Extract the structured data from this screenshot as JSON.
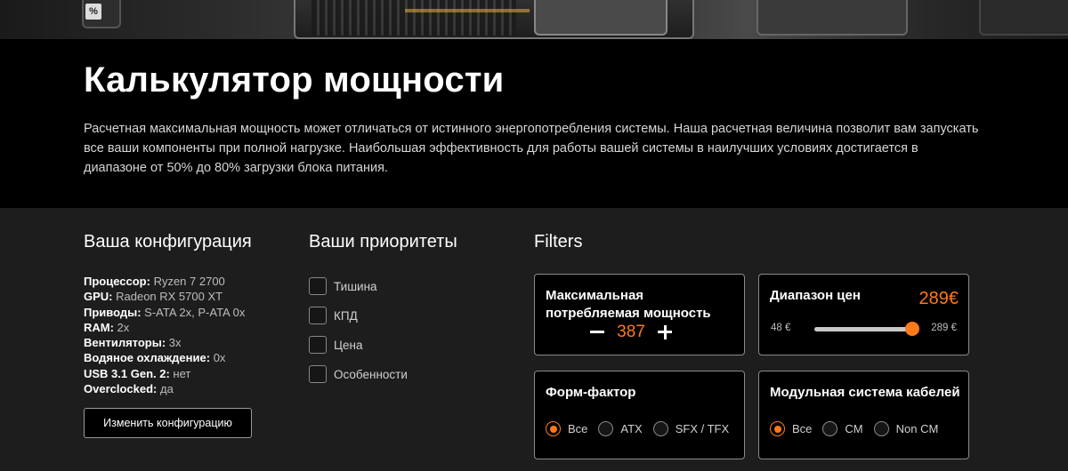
{
  "hero": {
    "title": "Калькулятор мощности",
    "description": "Расчетная максимальная мощность может отличаться от истинного энергопотребления системы. Наша расчетная величина позволит вам запускать все ваши компоненты при полной нагрузке. Наибольшая эффективность для работы вашей системы в наилучших условиях достигается в диапазоне от 50% до 80% загрузки блока питания."
  },
  "banner": {
    "percent_icon_text": "%"
  },
  "config": {
    "heading": "Ваша конфигурация",
    "specs": [
      {
        "key": "Процессор:",
        "value": " Ryzen 7 2700"
      },
      {
        "key": "GPU:",
        "value": " Radeon RX 5700 XT"
      },
      {
        "key": "Приводы:",
        "value": " S-ATA 2x, P-ATA 0x"
      },
      {
        "key": "RAM:",
        "value": " 2x"
      },
      {
        "key": "Вентиляторы:",
        "value": " 3x"
      },
      {
        "key": "Водяное охлаждение:",
        "value": " 0x"
      },
      {
        "key": "USB 3.1 Gen. 2:",
        "value": " нет"
      },
      {
        "key": "Overclocked:",
        "value": " да"
      }
    ],
    "change_button": "Изменить конфигурацию"
  },
  "priorities": {
    "heading": "Ваши приоритеты",
    "items": [
      {
        "label": "Тишина",
        "checked": false
      },
      {
        "label": "КПД",
        "checked": false
      },
      {
        "label": "Цена",
        "checked": false
      },
      {
        "label": "Особенности",
        "checked": false
      }
    ]
  },
  "filters": {
    "heading": "Filters",
    "power": {
      "title": "Максимальная потребляемая мощность",
      "value": "387"
    },
    "price": {
      "title": "Диапазон цен",
      "current": "289€",
      "min_label": "48 €",
      "max_label": "289 €",
      "slider_fraction": 1.0
    },
    "form_factor": {
      "title": "Форм-фактор",
      "options": [
        "Все",
        "ATX",
        "SFX / TFX"
      ],
      "selected": "Все"
    },
    "modular": {
      "title": "Модульная система кабелей",
      "options": [
        "Все",
        "CM",
        "Non CM"
      ],
      "selected": "Все"
    }
  },
  "colors": {
    "accent": "#ff7a1a",
    "background": "#000000",
    "panel": "#1d1d1d"
  }
}
